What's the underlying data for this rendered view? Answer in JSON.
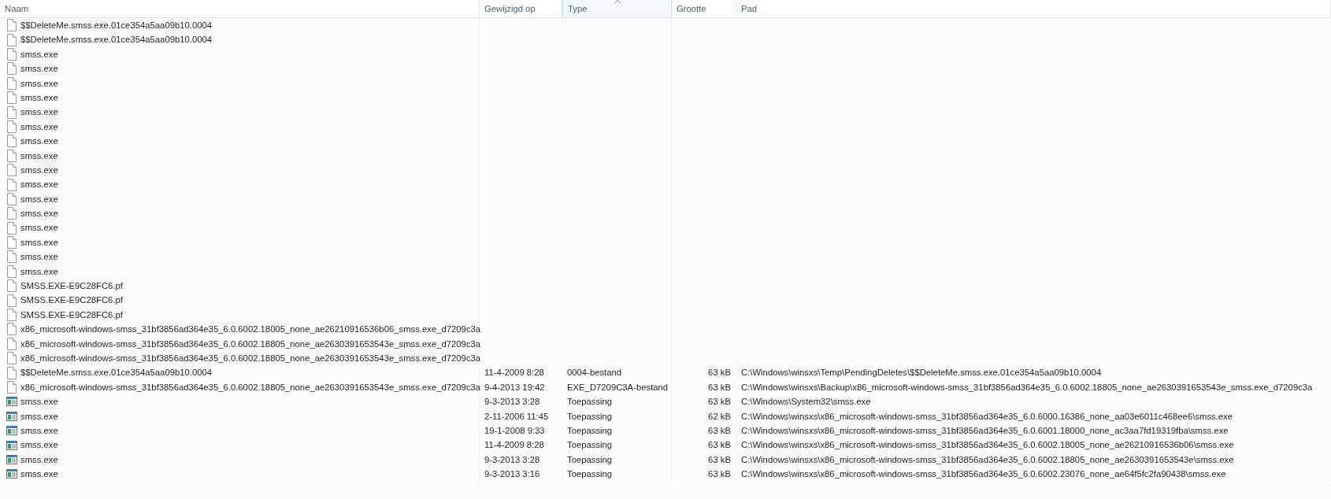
{
  "columns": [
    {
      "label": "Naam",
      "sorted": false
    },
    {
      "label": "Gewijzigd op",
      "sorted": false
    },
    {
      "label": "Type",
      "sorted": true
    },
    {
      "label": "Grootte",
      "sorted": false
    },
    {
      "label": "Pad",
      "sorted": false
    }
  ],
  "rows": [
    {
      "kind": "file",
      "name": "$$DeleteMe.smss.exe.01ce354a5aa09b10.0004"
    },
    {
      "kind": "file",
      "name": "$$DeleteMe.smss.exe.01ce354a5aa09b10.0004"
    },
    {
      "kind": "file",
      "name": "smss.exe"
    },
    {
      "kind": "file",
      "name": "smss.exe"
    },
    {
      "kind": "file",
      "name": "smss.exe"
    },
    {
      "kind": "file",
      "name": "smss.exe"
    },
    {
      "kind": "file",
      "name": "smss.exe"
    },
    {
      "kind": "file",
      "name": "smss.exe"
    },
    {
      "kind": "file",
      "name": "smss.exe"
    },
    {
      "kind": "file",
      "name": "smss.exe"
    },
    {
      "kind": "file",
      "name": "smss.exe"
    },
    {
      "kind": "file",
      "name": "smss.exe"
    },
    {
      "kind": "file",
      "name": "smss.exe"
    },
    {
      "kind": "file",
      "name": "smss.exe"
    },
    {
      "kind": "file",
      "name": "smss.exe"
    },
    {
      "kind": "file",
      "name": "smss.exe"
    },
    {
      "kind": "file",
      "name": "smss.exe"
    },
    {
      "kind": "file",
      "name": "smss.exe"
    },
    {
      "kind": "file",
      "name": "SMSS.EXE-E9C28FC6.pf"
    },
    {
      "kind": "file",
      "name": "SMSS.EXE-E9C28FC6.pf"
    },
    {
      "kind": "file",
      "name": "SMSS.EXE-E9C28FC6.pf"
    },
    {
      "kind": "file",
      "name": "x86_microsoft-windows-smss_31bf3856ad364e35_6.0.6002.18005_none_ae26210916536b06_smss.exe_d7209c3a"
    },
    {
      "kind": "file",
      "name": "x86_microsoft-windows-smss_31bf3856ad364e35_6.0.6002.18805_none_ae2630391653543e_smss.exe_d7209c3a"
    },
    {
      "kind": "file",
      "name": "x86_microsoft-windows-smss_31bf3856ad364e35_6.0.6002.18805_none_ae2630391653543e_smss.exe_d7209c3a"
    },
    {
      "kind": "file",
      "name": "$$DeleteMe.smss.exe.01ce354a5aa09b10.0004",
      "modified": "11-4-2009 8:28",
      "type": "0004-bestand",
      "size": "63 kB",
      "path": "C:\\Windows\\winsxs\\Temp\\PendingDeletes\\$$DeleteMe.smss.exe.01ce354a5aa09b10.0004"
    },
    {
      "kind": "file",
      "name": "x86_microsoft-windows-smss_31bf3856ad364e35_6.0.6002.18805_none_ae2630391653543e_smss.exe_d7209c3a",
      "modified": "9-4-2013 19:42",
      "type": "EXE_D7209C3A-bestand",
      "size": "63 kB",
      "path": "C:\\Windows\\winsxs\\Backup\\x86_microsoft-windows-smss_31bf3856ad364e35_6.0.6002.18805_none_ae2630391653543e_smss.exe_d7209c3a"
    },
    {
      "kind": "app",
      "name": "smss.exe",
      "modified": "9-3-2013 3:28",
      "type": "Toepassing",
      "size": "63 kB",
      "path": "C:\\Windows\\System32\\smss.exe"
    },
    {
      "kind": "app",
      "name": "smss.exe",
      "modified": "2-11-2006 11:45",
      "type": "Toepassing",
      "size": "62 kB",
      "path": "C:\\Windows\\winsxs\\x86_microsoft-windows-smss_31bf3856ad364e35_6.0.6000.16386_none_aa03e6011c468ee6\\smss.exe"
    },
    {
      "kind": "app",
      "name": "smss.exe",
      "modified": "19-1-2008 9:33",
      "type": "Toepassing",
      "size": "63 kB",
      "path": "C:\\Windows\\winsxs\\x86_microsoft-windows-smss_31bf3856ad364e35_6.0.6001.18000_none_ac3aa7fd19319fba\\smss.exe"
    },
    {
      "kind": "app",
      "name": "smss.exe",
      "modified": "11-4-2009 8:28",
      "type": "Toepassing",
      "size": "63 kB",
      "path": "C:\\Windows\\winsxs\\x86_microsoft-windows-smss_31bf3856ad364e35_6.0.6002.18005_none_ae26210916536b06\\smss.exe"
    },
    {
      "kind": "app",
      "name": "smss.exe",
      "modified": "9-3-2013 3:28",
      "type": "Toepassing",
      "size": "63 kB",
      "path": "C:\\Windows\\winsxs\\x86_microsoft-windows-smss_31bf3856ad364e35_6.0.6002.18805_none_ae2630391653543e\\smss.exe"
    },
    {
      "kind": "app",
      "name": "smss.exe",
      "modified": "9-3-2013 3:16",
      "type": "Toepassing",
      "size": "63 kB",
      "path": "C:\\Windows\\winsxs\\x86_microsoft-windows-smss_31bf3856ad364e35_6.0.6002.23076_none_ae64f5fc2fa90438\\smss.exe"
    }
  ]
}
